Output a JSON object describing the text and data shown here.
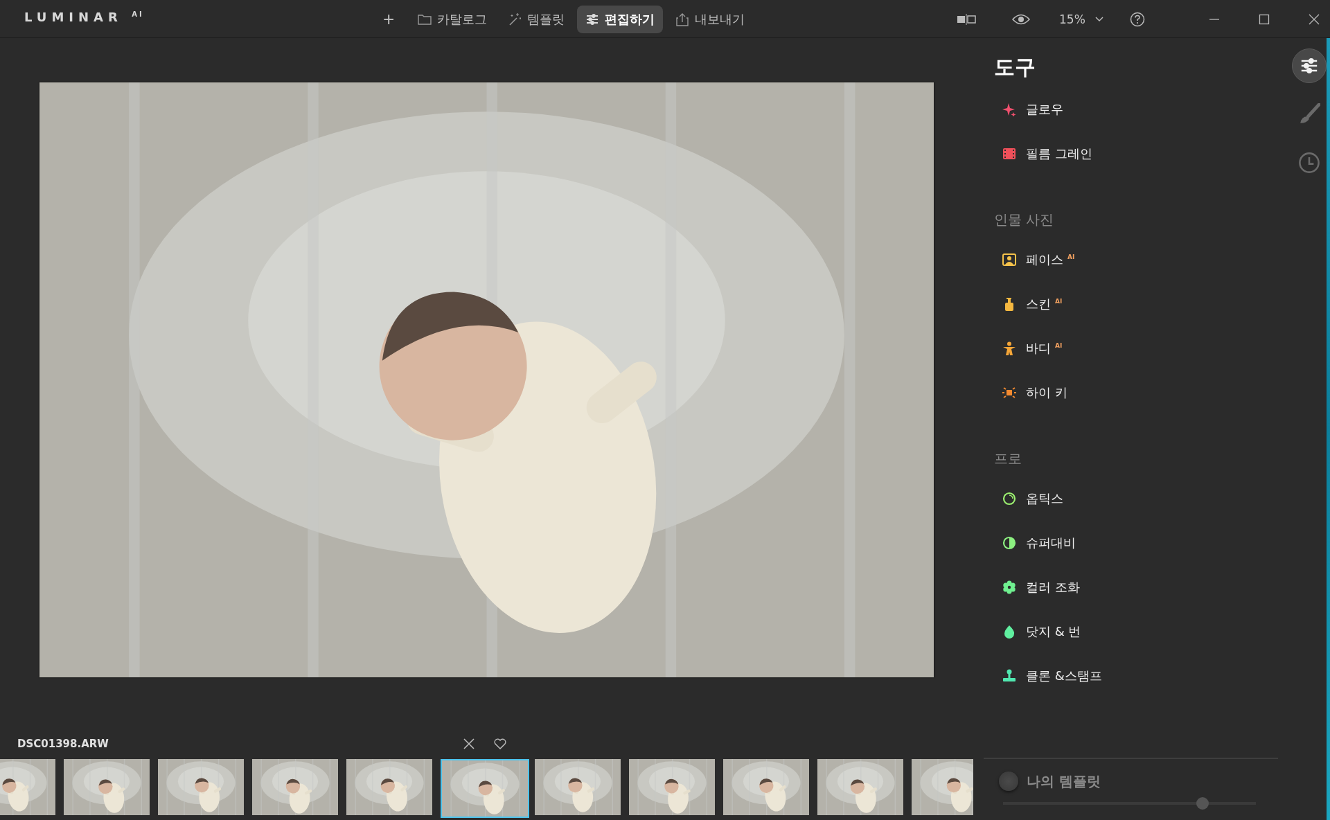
{
  "app": {
    "logo": "LUMINAR $^{AI}$"
  },
  "toolbar": {
    "add": "+",
    "tabs": [
      {
        "label": "카탈로그",
        "kind": "folder",
        "selected": false
      },
      {
        "label": "템플릿",
        "kind": "wand",
        "selected": false
      },
      {
        "label": "편집하기",
        "kind": "sliders",
        "selected": true
      },
      {
        "label": "내보내기",
        "kind": "share",
        "selected": false
      }
    ],
    "zoom": "15%"
  },
  "tools": {
    "title": "도구",
    "sections": [
      {
        "items": [
          {
            "label": "글로우",
            "kind": "sparkle",
            "color": "#f0506e"
          },
          {
            "label": "필름 그레인",
            "kind": "film",
            "color": "#f0505a"
          }
        ]
      },
      {
        "title": "인물 사진",
        "items": [
          {
            "label": "페이스",
            "kind": "portrait",
            "color": "#f5c24a",
            "tag": "AI"
          },
          {
            "label": "스킨",
            "kind": "bottle",
            "color": "#f5b840",
            "tag": "AI"
          },
          {
            "label": "바디",
            "kind": "person",
            "color": "#f5a638",
            "tag": "AI"
          },
          {
            "label": "하이 키",
            "kind": "sun",
            "color": "#f58a30"
          }
        ]
      },
      {
        "title": "프로",
        "items": [
          {
            "label": "옵틱스",
            "kind": "ring",
            "color": "#9cf070"
          },
          {
            "label": "슈퍼대비",
            "kind": "contrast",
            "color": "#8cf080"
          },
          {
            "label": "컬러 조화",
            "kind": "flower",
            "color": "#70f090"
          },
          {
            "label": "닷지 & 번",
            "kind": "drop",
            "color": "#60f0a0"
          },
          {
            "label": "클론 &스탬프",
            "kind": "stamp",
            "color": "#50e8b0"
          }
        ]
      }
    ]
  },
  "rail": [
    {
      "kind": "sliders",
      "selected": true
    },
    {
      "kind": "brush",
      "selected": false
    },
    {
      "kind": "clock",
      "selected": false
    }
  ],
  "templates": {
    "label": "나의 템플릿",
    "on": false,
    "level": 0.79
  },
  "filmstrip": {
    "filename": "DSC01398.ARW",
    "thumbnails": [
      {
        "selected": false
      },
      {
        "selected": false
      },
      {
        "selected": false
      },
      {
        "selected": false
      },
      {
        "selected": false
      },
      {
        "selected": true
      },
      {
        "selected": false
      },
      {
        "selected": false
      },
      {
        "selected": false
      },
      {
        "selected": false
      },
      {
        "selected": false
      }
    ]
  }
}
